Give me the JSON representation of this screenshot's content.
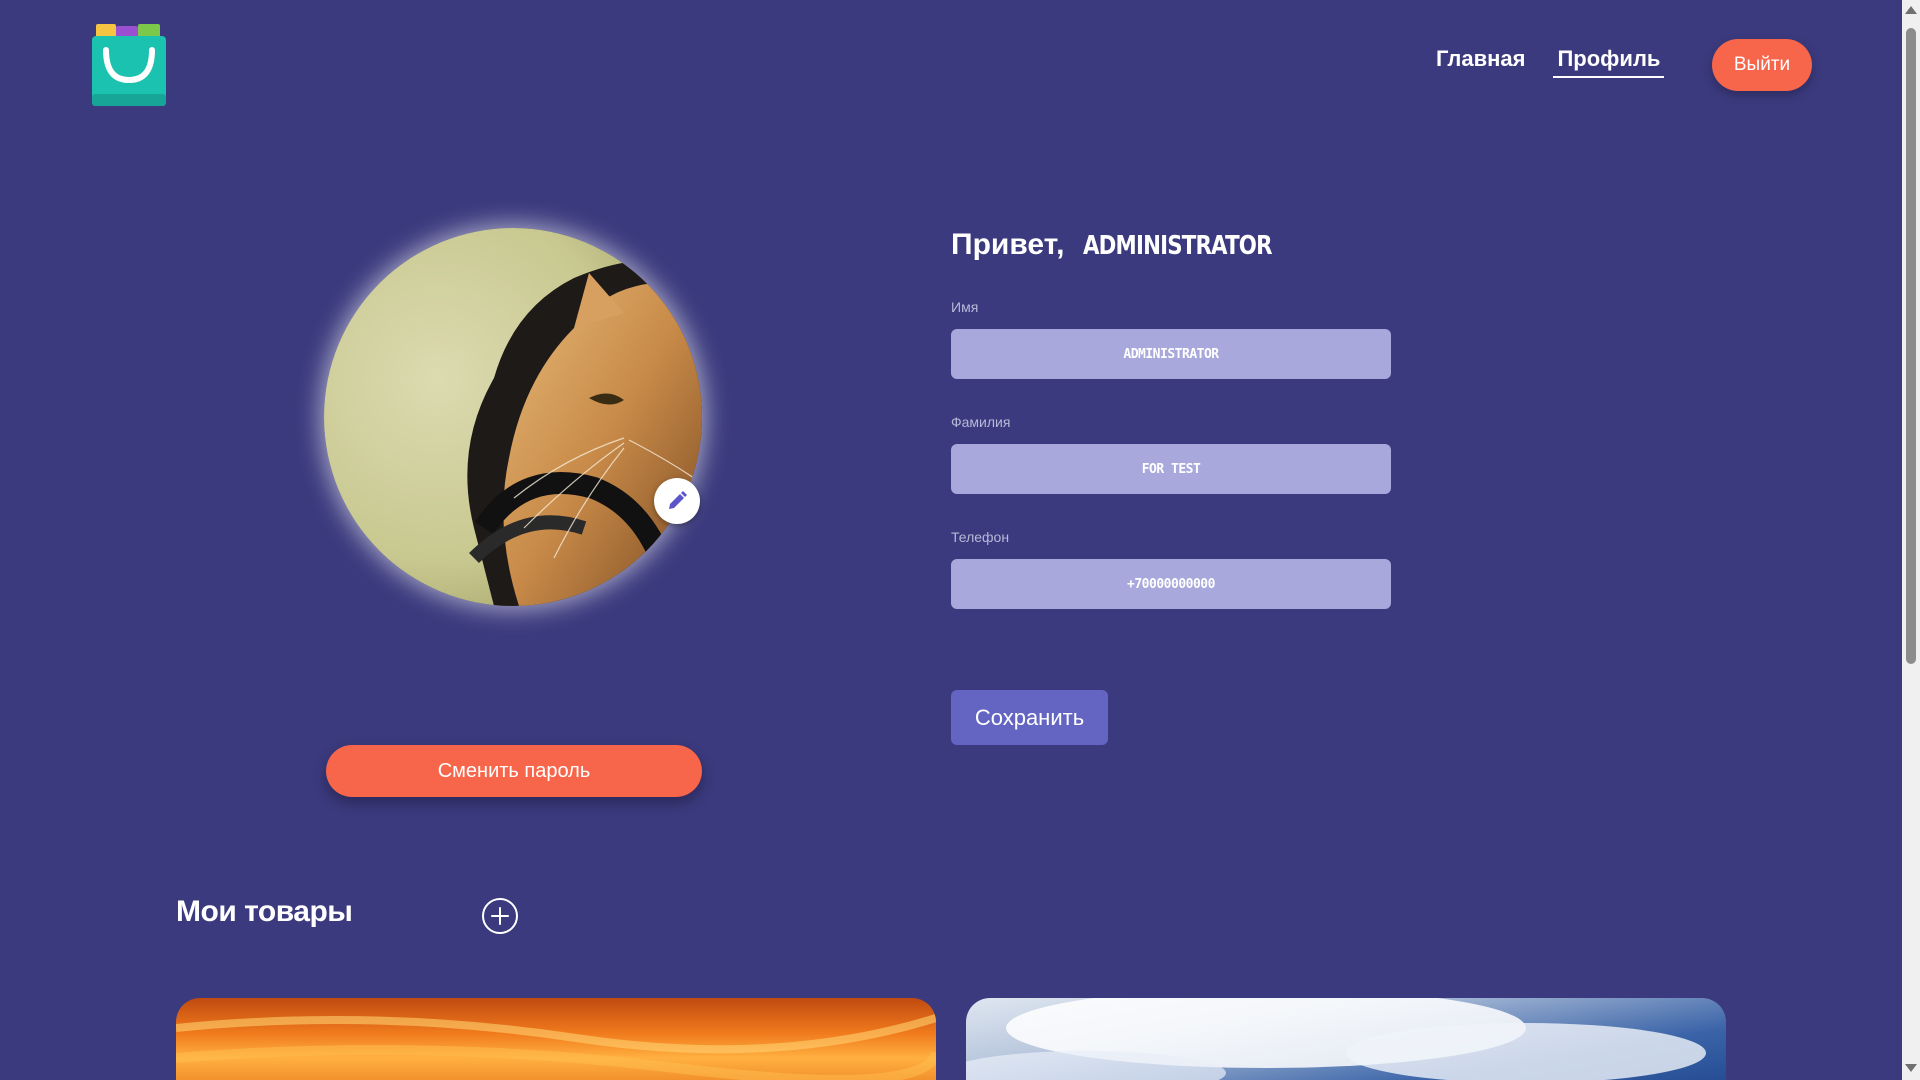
{
  "header": {
    "logo_icon": "shopping-bag-icon",
    "nav": [
      {
        "label": "Главная"
      },
      {
        "label": "Профиль"
      }
    ],
    "logout_label": "Выйти"
  },
  "profile": {
    "avatar_icon": "cat-with-headphones-photo",
    "edit_icon": "pencil-icon",
    "change_password_label": "Сменить пароль",
    "greeting": "Привет,",
    "username": "ADMINISTRATOR",
    "fields": [
      {
        "label": "Имя",
        "value": "ADMINISTRATOR"
      },
      {
        "label": "Фамилия",
        "value": "FOR TEST"
      },
      {
        "label": "Телефон",
        "value": "+70000000000"
      }
    ],
    "save_label": "Сохранить"
  },
  "products": {
    "title": "Мои товары",
    "add_icon": "plus-circle-icon"
  },
  "colors": {
    "background": "#3b3a7e",
    "accent_orange": "#f7654a",
    "field_bg": "#a8a8dc",
    "save_button": "#6465c2"
  }
}
